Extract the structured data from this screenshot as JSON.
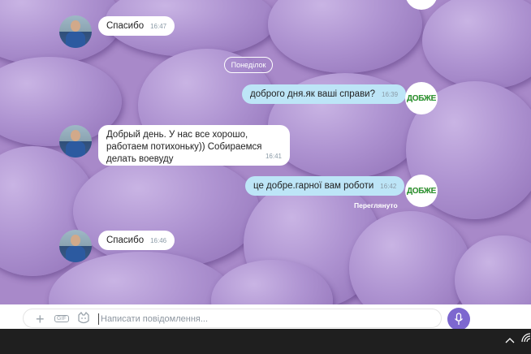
{
  "day_separator": "Понеділок",
  "messages": [
    {
      "text": "Спасибо",
      "time": "16:47"
    },
    {
      "text": "доброго дня.як ваші справи?",
      "time": "16:39"
    },
    {
      "text": "Добрый день. У нас все хорошо, работаем потихоньку))  Собираемся делать воевуду",
      "time": "16:41"
    },
    {
      "text": "це добре.гарної вам роботи",
      "time": "16:42"
    },
    {
      "text": "Спасибо",
      "time": "16:46"
    }
  ],
  "bot_avatar_label": "ДОБЖЕ",
  "seen_label": "Переглянуто",
  "composer": {
    "placeholder": "Написати повідомлення..."
  },
  "colors": {
    "incoming": "#ffffff",
    "outgoing": "#bde5f7",
    "accent": "#7d67cf",
    "background": "#a889c9"
  },
  "icons": [
    "plus-icon",
    "gif-icon",
    "sticker-icon",
    "mic-icon",
    "chevron-up-icon",
    "wifi-icon"
  ]
}
